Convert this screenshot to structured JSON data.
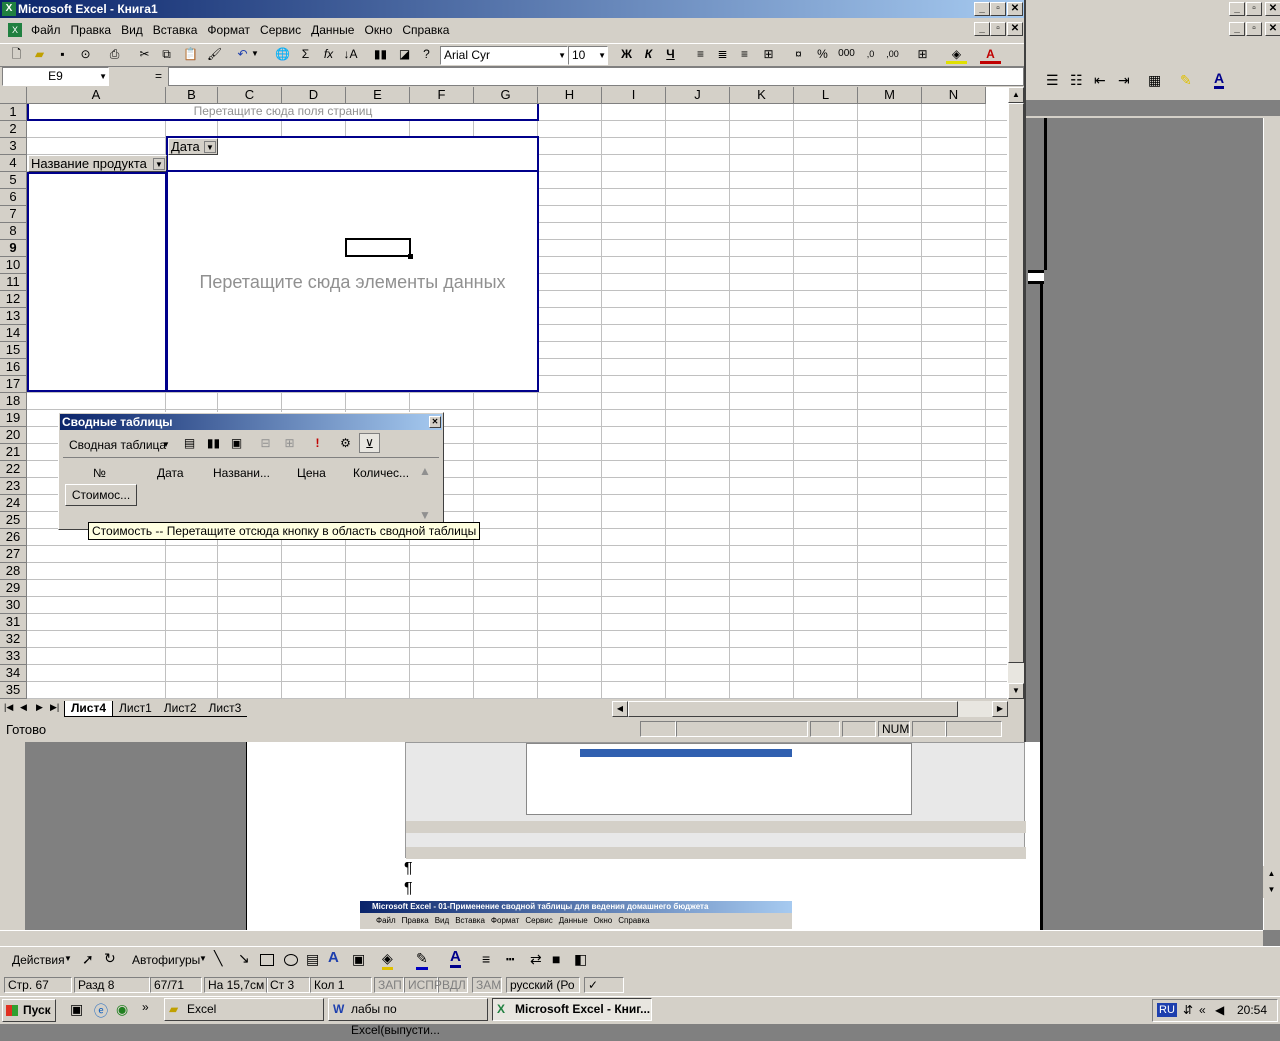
{
  "window": {
    "title": "Microsoft Excel - Книга1"
  },
  "menu": [
    "Файл",
    "Правка",
    "Вид",
    "Вставка",
    "Формат",
    "Сервис",
    "Данные",
    "Окно",
    "Справка"
  ],
  "format": {
    "font": "Arial Cyr",
    "size": "10"
  },
  "formula": {
    "namebox": "E9",
    "eq": "="
  },
  "columns": [
    "A",
    "B",
    "C",
    "D",
    "E",
    "F",
    "G",
    "H",
    "I",
    "J",
    "K",
    "L",
    "M",
    "N"
  ],
  "rows": [
    "1",
    "2",
    "3",
    "4",
    "5",
    "6",
    "7",
    "8",
    "9",
    "10",
    "11",
    "12",
    "13",
    "14",
    "15",
    "16",
    "17",
    "18",
    "19",
    "20",
    "21",
    "22",
    "23",
    "24",
    "25",
    "26",
    "27",
    "28",
    "29",
    "30",
    "31",
    "32",
    "33",
    "34",
    "35"
  ],
  "pivot": {
    "page_hint": "Перетащите сюда поля страниц",
    "col_field": "Дата",
    "row_field": "Название продукта",
    "data_hint": "Перетащите сюда элементы данных"
  },
  "pivot_toolbar": {
    "title": "Сводные таблицы",
    "menu": "Сводная таблица",
    "fields": [
      "№",
      "Дата",
      "Названи...",
      "Цена",
      "Количес..."
    ],
    "button": "Стоимос...",
    "tooltip": "Стоимость -- Перетащите отсюда кнопку в область сводной таблицы"
  },
  "sheets": [
    "Лист4",
    "Лист1",
    "Лист2",
    "Лист3"
  ],
  "status": {
    "ready": "Готово",
    "num": "NUM"
  },
  "word_mini": {
    "title1": "Microsoft Excel - 01-Применение сводной таблицы для ведения домашнего бюджета",
    "title2": "Microsoft Excel - 01-Применение сводной таблицы для ведения домашнего бюджета",
    "menu": [
      "Файл",
      "Правка",
      "Вид",
      "Вставка",
      "Формат",
      "Сервис",
      "Данные",
      "Окно",
      "Справка"
    ],
    "pilcrow": "¶"
  },
  "drawing": {
    "actions": "Действия",
    "autoshapes": "Автофигуры"
  },
  "word_status": [
    "Стр. 67",
    "Разд 8",
    "67/71",
    "На 15,7см",
    "Ст 3",
    "Кол 1",
    "ЗАП",
    "ИСПР",
    "ВДЛ",
    "ЗАМ",
    "русский (Ро"
  ],
  "taskbar": {
    "start": "Пуск",
    "items": [
      "Excel",
      "лабы по Excel(выпусти...",
      "Microsoft Excel - Книг..."
    ],
    "lang": "RU",
    "time": "20:54"
  },
  "colors": {
    "titlebar": "#0a246a",
    "pivot_border": "#00008b",
    "face": "#d4d0c8"
  }
}
